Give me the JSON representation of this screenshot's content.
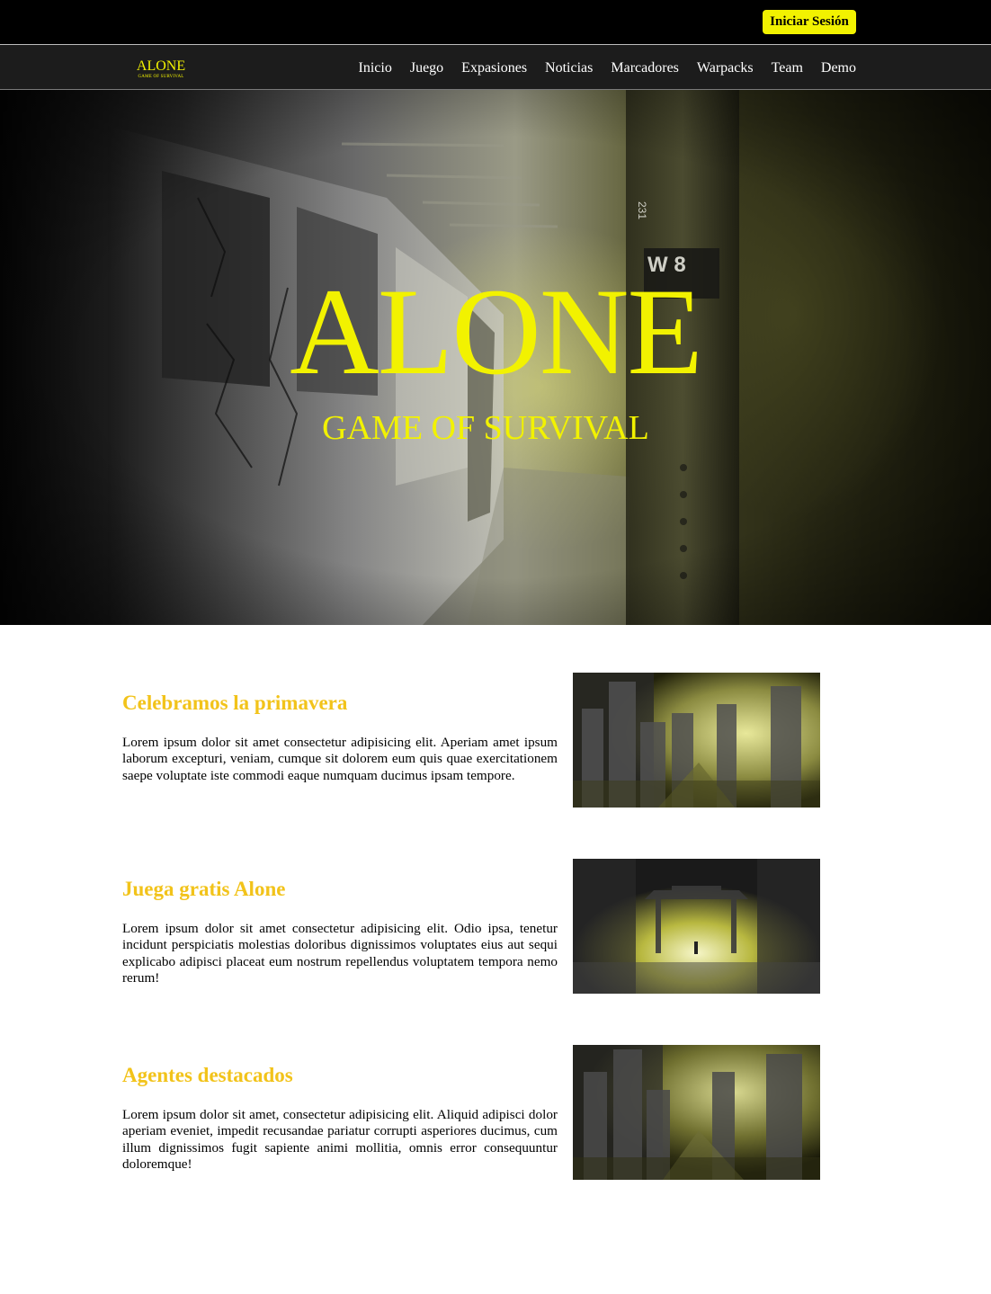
{
  "topbar": {
    "login_label": "Iniciar Sesión"
  },
  "navbar": {
    "logo_title": "ALONE",
    "logo_subtitle": "GAME OF SURVIVAL",
    "items": [
      "Inicio",
      "Juego",
      "Expasiones",
      "Noticias",
      "Marcadores",
      "Warpacks",
      "Team",
      "Demo"
    ]
  },
  "hero": {
    "title": "ALONE",
    "subtitle": "GAME OF SURVIVAL",
    "sign_text": "W 8",
    "sign_number": "231"
  },
  "features": [
    {
      "title": "Celebramos la primavera",
      "text": "Lorem ipsum dolor sit amet consectetur adipisicing elit. Aperiam amet ipsum laborum excepturi, veniam, cumque sit dolorem eum quis quae exercitationem saepe voluptate iste commodi eaque numquam ducimus ipsam tempore."
    },
    {
      "title": "Juega gratis Alone",
      "text": "Lorem ipsum dolor sit amet consectetur adipisicing elit. Odio ipsa, tenetur incidunt perspiciatis molestias doloribus dignissimos voluptates eius aut sequi explicabo adipisci placeat eum nostrum repellendus voluptatem tempora nemo rerum!"
    },
    {
      "title": "Agentes destacados",
      "text": "Lorem ipsum dolor sit amet, consectetur adipisicing elit. Aliquid adipisci dolor aperiam eveniet, impedit recusandae pariatur corrupti asperiores ducimus, cum illum dignissimos fugit sapiente animi mollitia, omnis error consequuntur doloremque!"
    }
  ],
  "colors": {
    "accent_yellow": "#f2f200",
    "heading_gold": "#f2c31a",
    "topbar_bg": "#000000",
    "navbar_bg": "#1c1c1c"
  }
}
